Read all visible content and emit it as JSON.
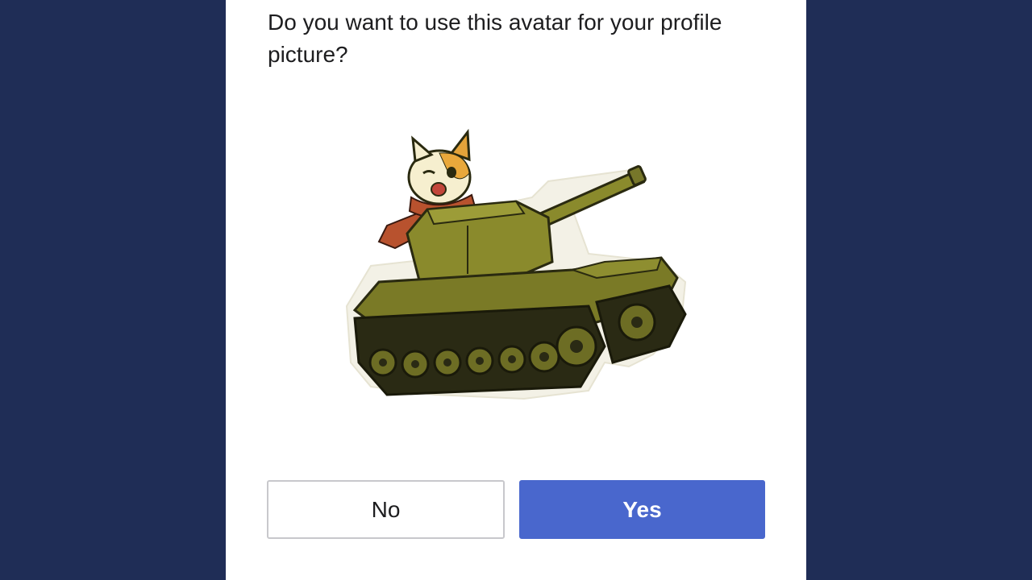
{
  "dialog": {
    "question": "Do you want to use this avatar for your profile picture?",
    "no_label": "No",
    "yes_label": "Yes"
  },
  "avatar": {
    "name": "cat-in-tank-avatar"
  },
  "colors": {
    "background": "#1f2d56",
    "panel": "#ffffff",
    "primary_button": "#4967cd",
    "tank_olive": "#7a7a26"
  }
}
